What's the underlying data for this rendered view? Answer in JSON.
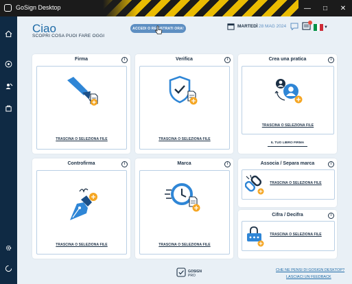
{
  "window": {
    "title": "GoSign Desktop"
  },
  "header": {
    "greeting": "Ciao",
    "subtitle": "SCOPRI COSA PUOI FARE OGGI",
    "login_button": "ACCEDI O REGISTRATI ORA!",
    "day": "MARTEDÌ",
    "date": "28 MAG 2024",
    "language": "it"
  },
  "cards": {
    "firma": {
      "title": "Firma",
      "link": "TRASCINA O SELEZIONA FILE"
    },
    "verifica": {
      "title": "Verifica",
      "link": "TRASCINA O SELEZIONA FILE"
    },
    "pratica": {
      "title": "Crea una pratica",
      "link": "TRASCINA O SELEZIONA FILE",
      "book_button": "IL TUO LIBRO FIRMA"
    },
    "controfirma": {
      "title": "Controfirma",
      "link": "TRASCINA O SELEZIONA FILE"
    },
    "marca": {
      "title": "Marca",
      "link": "TRASCINA O SELEZIONA FILE"
    },
    "associa": {
      "title": "Associa / Separa marca",
      "link": "TRASCINA O SELEZIONA FILE"
    },
    "cifra": {
      "title": "Cifra / Decifra",
      "link": "TRASCINA O SELEZIONA FILE"
    }
  },
  "footer": {
    "logo_line1": "GOSIGN",
    "logo_line2": "PRO",
    "feedback_question": "CHE NE PENSI DI GOSIGN DESKTOP?",
    "feedback_link": "LASCIACI UN FEEDBACK"
  },
  "colors": {
    "accent": "#1e6aa6",
    "sidebar": "#0f2a44",
    "orange": "#f5a623",
    "icon_blue": "#2f86d6"
  }
}
